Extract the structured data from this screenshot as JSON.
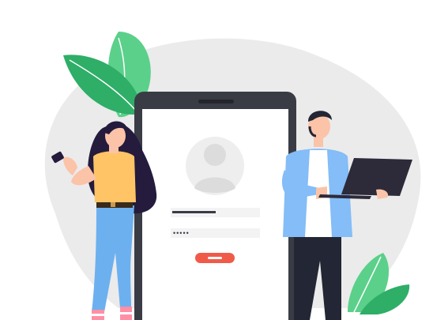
{
  "illustration": {
    "password_mask": "•••••",
    "colors": {
      "blob": "#ebebeb",
      "phone_frame": "#3a3c45",
      "screen": "#ffffff",
      "avatar_bg": "#eeeeee",
      "avatar_fg": "#dcdcdc",
      "field_bg": "#f3f3f3",
      "username_text": "#3a3c45",
      "login_button": "#ef5b48",
      "leaf_green": "#5bd08a",
      "leaf_dark": "#2eae67",
      "woman_hair": "#241b3d",
      "woman_shirt": "#ffc466",
      "woman_jeans": "#6db0ef",
      "man_shirt": "#84bdf7",
      "man_pants": "#232634",
      "skin": "#fbc3a8",
      "laptop": "#2d2a3a"
    }
  }
}
